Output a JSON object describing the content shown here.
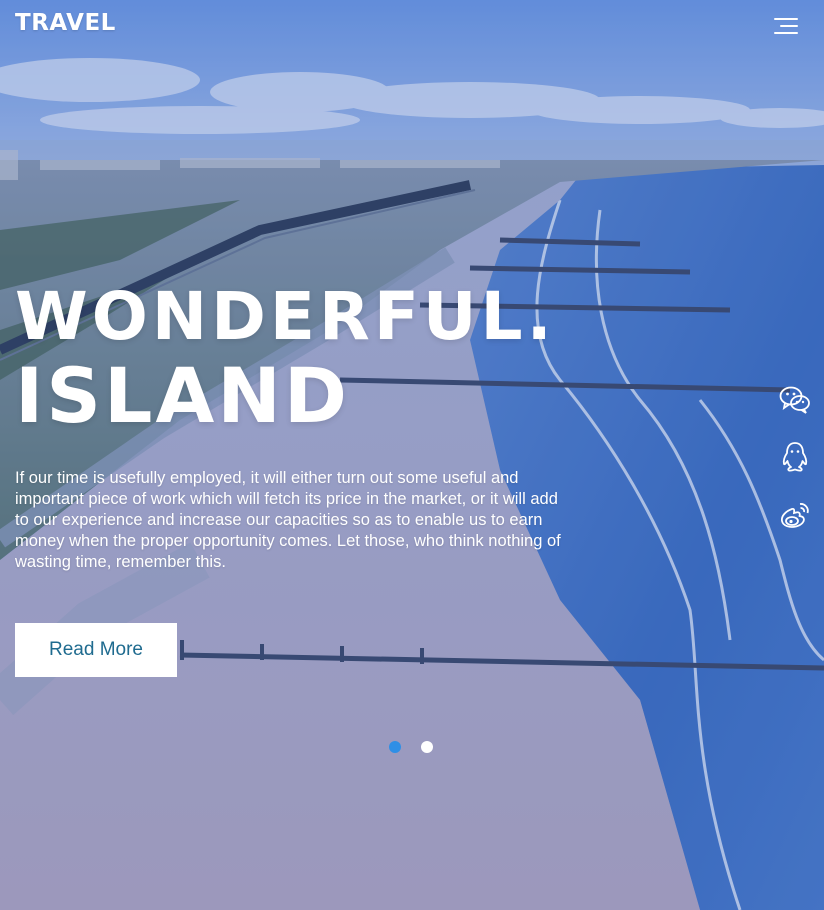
{
  "header": {
    "brand": "TRAVEL",
    "menu_icon": "hamburger-menu-icon"
  },
  "hero": {
    "headline_line1": "WONDERFUL.",
    "headline_line2": "ISLAND",
    "description": "If our time is usefully employed, it will either turn out some useful and important piece of work which will fetch its price in the market, or it will add to our experience and increase our capacities so as to enable us to earn money when the proper opportunity comes. Let those, who think nothing of wasting time, remember this.",
    "cta_label": "Read More"
  },
  "social": {
    "icons": [
      "wechat-icon",
      "qq-icon",
      "weibo-icon"
    ]
  },
  "slider": {
    "slide_count": 2,
    "active_index": 0
  },
  "colors": {
    "dot_active": "#2f8fe6",
    "dot_inactive": "#ffffff",
    "cta_text": "#1f6b8f",
    "cta_bg": "#ffffff"
  }
}
